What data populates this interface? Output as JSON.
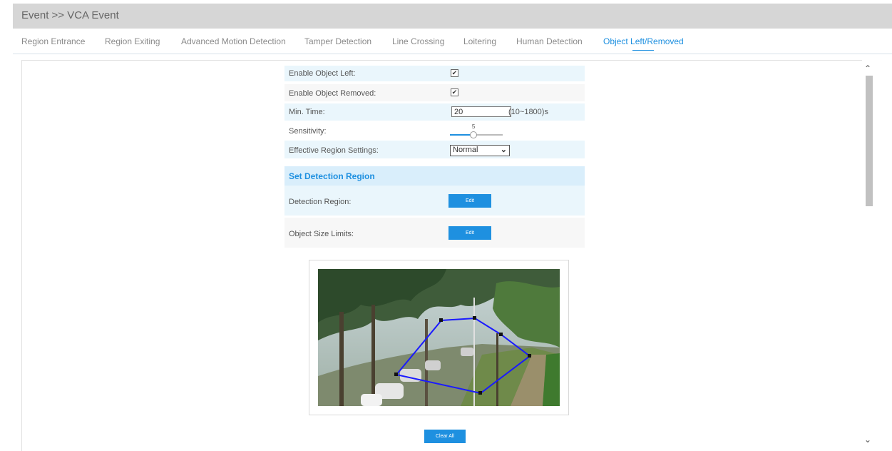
{
  "breadcrumb": "Event >> VCA Event",
  "tabs": [
    {
      "label": "Region Entrance",
      "active": false
    },
    {
      "label": "Region Exiting",
      "active": false
    },
    {
      "label": "Advanced Motion Detection",
      "active": false
    },
    {
      "label": "Tamper Detection",
      "active": false
    },
    {
      "label": "Line Crossing",
      "active": false
    },
    {
      "label": "Loitering",
      "active": false
    },
    {
      "label": "Human Detection",
      "active": false
    },
    {
      "label": "Object Left/Removed",
      "active": true
    }
  ],
  "settings": {
    "enable_object_left": {
      "label": "Enable Object Left:",
      "checked": true,
      "mark": "✔"
    },
    "enable_object_removed": {
      "label": "Enable Object Removed:",
      "checked": true,
      "mark": "✔"
    },
    "min_time": {
      "label": "Min. Time:",
      "value": "20",
      "range": "(10~1800)s"
    },
    "sensitivity": {
      "label": "Sensitivity:",
      "value": "5",
      "min": 1,
      "max": 10
    },
    "effective_region": {
      "label": "Effective Region Settings:",
      "value": "Normal"
    }
  },
  "detection": {
    "header": "Set Detection Region",
    "region_label": "Detection Region:",
    "region_button": "Edit",
    "size_label": "Object Size Limits:",
    "size_button": "Edit"
  },
  "clear_all": "Clear All",
  "colors": {
    "accent": "#1e90e0",
    "region_outline": "#1a1aff"
  },
  "icons": {
    "scroll_up": "⌃",
    "scroll_down": "⌄",
    "chevron": "⌄"
  }
}
